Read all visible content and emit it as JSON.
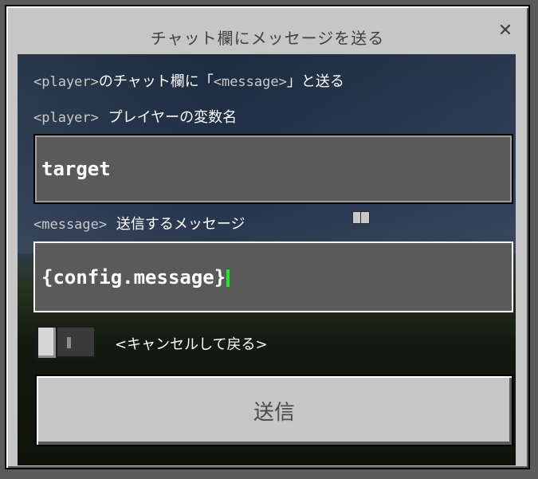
{
  "dialog": {
    "title": "チャット欄にメッセージを送る",
    "close_glyph": "✕"
  },
  "form": {
    "description_player_token": "<player>",
    "description_middle": "のチャット欄に「",
    "description_message_token": "<message>",
    "description_end": "」と送る",
    "player_field": {
      "token": "<player>",
      "label": "プレイヤーの変数名",
      "value": "target"
    },
    "message_field": {
      "token": "<message>",
      "label": "送信するメッセージ",
      "value": "{config.message}"
    },
    "cancel_toggle": {
      "label": "<キャンセルして戻る>",
      "state": "off"
    },
    "send_button_label": "送信"
  },
  "colors": {
    "panel_bg": "#c6c6c6",
    "input_bg": "#5a5a5a",
    "caret": "#22e822"
  }
}
